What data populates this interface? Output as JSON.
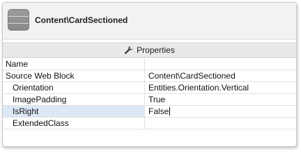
{
  "header": {
    "icon": "widget-block-icon",
    "title": "Content\\CardSectioned"
  },
  "tabs": {
    "properties": {
      "icon": "wrench-icon",
      "label": "Properties"
    }
  },
  "properties": [
    {
      "name": "Name",
      "value": ""
    },
    {
      "name": "Source Web Block",
      "value": "Content\\CardSectioned"
    },
    {
      "name": "Orientation",
      "value": "Entities.Orientation.Vertical"
    },
    {
      "name": "ImagePadding",
      "value": "True"
    },
    {
      "name": "IsRight",
      "value": "False"
    },
    {
      "name": "ExtendedClass",
      "value": ""
    }
  ],
  "colors": {
    "selected_row": "#dce8f6",
    "header_bg": "#f2f2f2",
    "tabbar_bg": "#e9e9e9"
  }
}
